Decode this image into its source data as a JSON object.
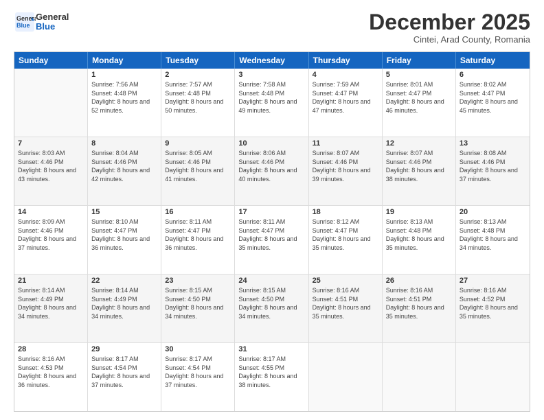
{
  "header": {
    "logo_general": "General",
    "logo_blue": "Blue",
    "month": "December 2025",
    "location": "Cintei, Arad County, Romania"
  },
  "weekdays": [
    "Sunday",
    "Monday",
    "Tuesday",
    "Wednesday",
    "Thursday",
    "Friday",
    "Saturday"
  ],
  "rows": [
    [
      {
        "day": "",
        "sunrise": "",
        "sunset": "",
        "daylight": ""
      },
      {
        "day": "1",
        "sunrise": "Sunrise: 7:56 AM",
        "sunset": "Sunset: 4:48 PM",
        "daylight": "Daylight: 8 hours and 52 minutes."
      },
      {
        "day": "2",
        "sunrise": "Sunrise: 7:57 AM",
        "sunset": "Sunset: 4:48 PM",
        "daylight": "Daylight: 8 hours and 50 minutes."
      },
      {
        "day": "3",
        "sunrise": "Sunrise: 7:58 AM",
        "sunset": "Sunset: 4:48 PM",
        "daylight": "Daylight: 8 hours and 49 minutes."
      },
      {
        "day": "4",
        "sunrise": "Sunrise: 7:59 AM",
        "sunset": "Sunset: 4:47 PM",
        "daylight": "Daylight: 8 hours and 47 minutes."
      },
      {
        "day": "5",
        "sunrise": "Sunrise: 8:01 AM",
        "sunset": "Sunset: 4:47 PM",
        "daylight": "Daylight: 8 hours and 46 minutes."
      },
      {
        "day": "6",
        "sunrise": "Sunrise: 8:02 AM",
        "sunset": "Sunset: 4:47 PM",
        "daylight": "Daylight: 8 hours and 45 minutes."
      }
    ],
    [
      {
        "day": "7",
        "sunrise": "Sunrise: 8:03 AM",
        "sunset": "Sunset: 4:46 PM",
        "daylight": "Daylight: 8 hours and 43 minutes."
      },
      {
        "day": "8",
        "sunrise": "Sunrise: 8:04 AM",
        "sunset": "Sunset: 4:46 PM",
        "daylight": "Daylight: 8 hours and 42 minutes."
      },
      {
        "day": "9",
        "sunrise": "Sunrise: 8:05 AM",
        "sunset": "Sunset: 4:46 PM",
        "daylight": "Daylight: 8 hours and 41 minutes."
      },
      {
        "day": "10",
        "sunrise": "Sunrise: 8:06 AM",
        "sunset": "Sunset: 4:46 PM",
        "daylight": "Daylight: 8 hours and 40 minutes."
      },
      {
        "day": "11",
        "sunrise": "Sunrise: 8:07 AM",
        "sunset": "Sunset: 4:46 PM",
        "daylight": "Daylight: 8 hours and 39 minutes."
      },
      {
        "day": "12",
        "sunrise": "Sunrise: 8:07 AM",
        "sunset": "Sunset: 4:46 PM",
        "daylight": "Daylight: 8 hours and 38 minutes."
      },
      {
        "day": "13",
        "sunrise": "Sunrise: 8:08 AM",
        "sunset": "Sunset: 4:46 PM",
        "daylight": "Daylight: 8 hours and 37 minutes."
      }
    ],
    [
      {
        "day": "14",
        "sunrise": "Sunrise: 8:09 AM",
        "sunset": "Sunset: 4:46 PM",
        "daylight": "Daylight: 8 hours and 37 minutes."
      },
      {
        "day": "15",
        "sunrise": "Sunrise: 8:10 AM",
        "sunset": "Sunset: 4:47 PM",
        "daylight": "Daylight: 8 hours and 36 minutes."
      },
      {
        "day": "16",
        "sunrise": "Sunrise: 8:11 AM",
        "sunset": "Sunset: 4:47 PM",
        "daylight": "Daylight: 8 hours and 36 minutes."
      },
      {
        "day": "17",
        "sunrise": "Sunrise: 8:11 AM",
        "sunset": "Sunset: 4:47 PM",
        "daylight": "Daylight: 8 hours and 35 minutes."
      },
      {
        "day": "18",
        "sunrise": "Sunrise: 8:12 AM",
        "sunset": "Sunset: 4:47 PM",
        "daylight": "Daylight: 8 hours and 35 minutes."
      },
      {
        "day": "19",
        "sunrise": "Sunrise: 8:13 AM",
        "sunset": "Sunset: 4:48 PM",
        "daylight": "Daylight: 8 hours and 35 minutes."
      },
      {
        "day": "20",
        "sunrise": "Sunrise: 8:13 AM",
        "sunset": "Sunset: 4:48 PM",
        "daylight": "Daylight: 8 hours and 34 minutes."
      }
    ],
    [
      {
        "day": "21",
        "sunrise": "Sunrise: 8:14 AM",
        "sunset": "Sunset: 4:49 PM",
        "daylight": "Daylight: 8 hours and 34 minutes."
      },
      {
        "day": "22",
        "sunrise": "Sunrise: 8:14 AM",
        "sunset": "Sunset: 4:49 PM",
        "daylight": "Daylight: 8 hours and 34 minutes."
      },
      {
        "day": "23",
        "sunrise": "Sunrise: 8:15 AM",
        "sunset": "Sunset: 4:50 PM",
        "daylight": "Daylight: 8 hours and 34 minutes."
      },
      {
        "day": "24",
        "sunrise": "Sunrise: 8:15 AM",
        "sunset": "Sunset: 4:50 PM",
        "daylight": "Daylight: 8 hours and 34 minutes."
      },
      {
        "day": "25",
        "sunrise": "Sunrise: 8:16 AM",
        "sunset": "Sunset: 4:51 PM",
        "daylight": "Daylight: 8 hours and 35 minutes."
      },
      {
        "day": "26",
        "sunrise": "Sunrise: 8:16 AM",
        "sunset": "Sunset: 4:51 PM",
        "daylight": "Daylight: 8 hours and 35 minutes."
      },
      {
        "day": "27",
        "sunrise": "Sunrise: 8:16 AM",
        "sunset": "Sunset: 4:52 PM",
        "daylight": "Daylight: 8 hours and 35 minutes."
      }
    ],
    [
      {
        "day": "28",
        "sunrise": "Sunrise: 8:16 AM",
        "sunset": "Sunset: 4:53 PM",
        "daylight": "Daylight: 8 hours and 36 minutes."
      },
      {
        "day": "29",
        "sunrise": "Sunrise: 8:17 AM",
        "sunset": "Sunset: 4:54 PM",
        "daylight": "Daylight: 8 hours and 37 minutes."
      },
      {
        "day": "30",
        "sunrise": "Sunrise: 8:17 AM",
        "sunset": "Sunset: 4:54 PM",
        "daylight": "Daylight: 8 hours and 37 minutes."
      },
      {
        "day": "31",
        "sunrise": "Sunrise: 8:17 AM",
        "sunset": "Sunset: 4:55 PM",
        "daylight": "Daylight: 8 hours and 38 minutes."
      },
      {
        "day": "",
        "sunrise": "",
        "sunset": "",
        "daylight": ""
      },
      {
        "day": "",
        "sunrise": "",
        "sunset": "",
        "daylight": ""
      },
      {
        "day": "",
        "sunrise": "",
        "sunset": "",
        "daylight": ""
      }
    ]
  ]
}
